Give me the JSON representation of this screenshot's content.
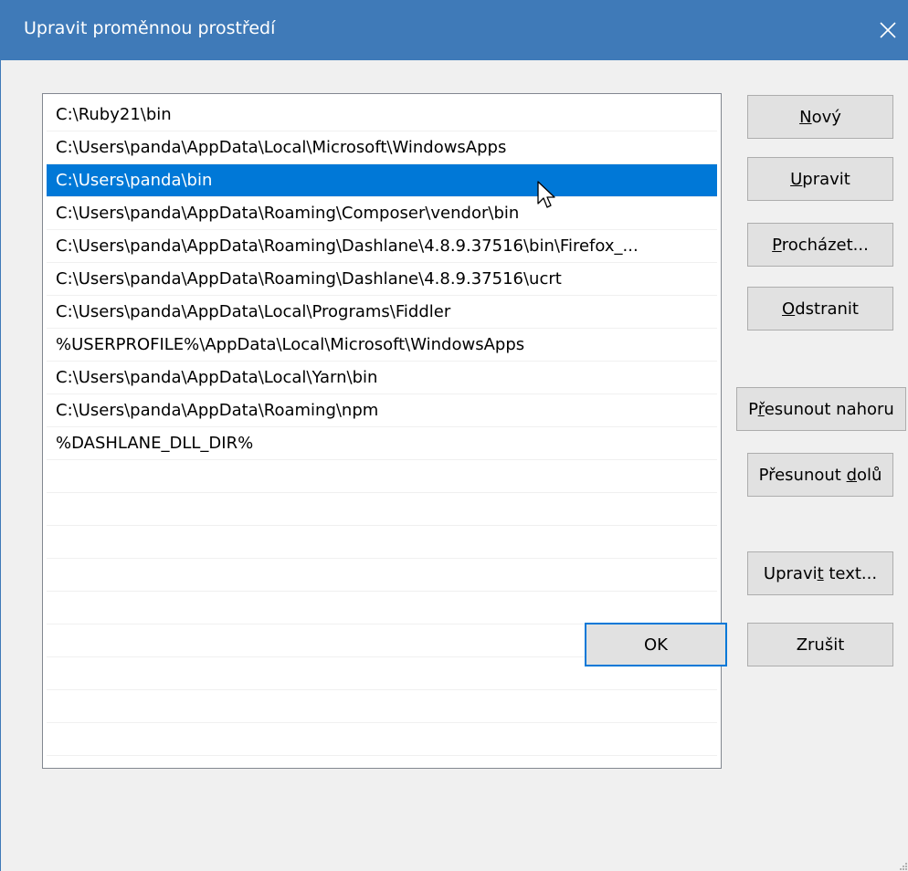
{
  "window": {
    "title": "Upravit proměnnou prostředí",
    "colors": {
      "titlebar": "#3f7ab8",
      "selection": "#0078d7",
      "button_face": "#e1e1e1"
    }
  },
  "paths": [
    "C:\\Ruby21\\bin",
    "C:\\Users\\panda\\AppData\\Local\\Microsoft\\WindowsApps",
    "C:\\Users\\panda\\bin",
    "C:\\Users\\panda\\AppData\\Roaming\\Composer\\vendor\\bin",
    "C:\\Users\\panda\\AppData\\Roaming\\Dashlane\\4.8.9.37516\\bin\\Firefox_...",
    "C:\\Users\\panda\\AppData\\Roaming\\Dashlane\\4.8.9.37516\\ucrt",
    "C:\\Users\\panda\\AppData\\Local\\Programs\\Fiddler",
    "%USERPROFILE%\\AppData\\Local\\Microsoft\\WindowsApps",
    "C:\\Users\\panda\\AppData\\Local\\Yarn\\bin",
    "C:\\Users\\panda\\AppData\\Roaming\\npm",
    "%DASHLANE_DLL_DIR%"
  ],
  "selected_index": 2,
  "buttons": {
    "new": {
      "pre": "",
      "key": "N",
      "post": "ový"
    },
    "edit": {
      "pre": "",
      "key": "U",
      "post": "pravit"
    },
    "browse": {
      "pre": "",
      "key": "P",
      "post": "rocházet..."
    },
    "delete": {
      "pre": "",
      "key": "O",
      "post": "dstranit"
    },
    "move_up": {
      "pre": "P",
      "key": "ř",
      "post": "esunout nahoru"
    },
    "move_down": {
      "pre": "Přesunout ",
      "key": "d",
      "post": "olů"
    },
    "edit_text": {
      "pre": "Upravi",
      "key": "t",
      "post": " text..."
    },
    "ok": "OK",
    "cancel": "Zrušit"
  },
  "icons": {
    "close": "close-icon",
    "cursor": "mouse-pointer-icon",
    "grip": "resize-grip-icon"
  }
}
